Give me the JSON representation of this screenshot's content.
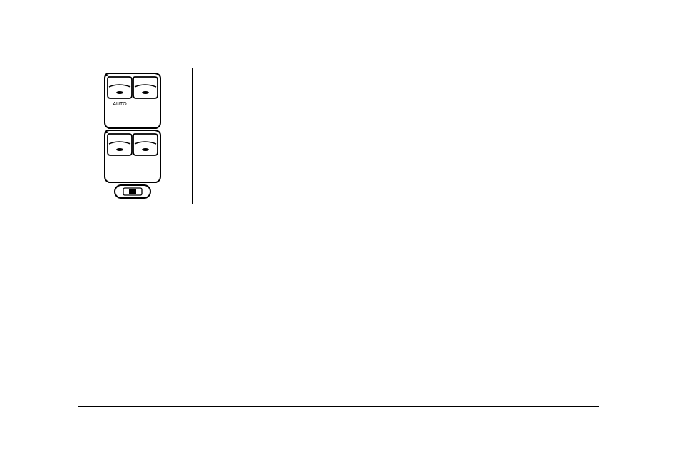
{
  "illustration": {
    "switch_label": "AUTO"
  }
}
